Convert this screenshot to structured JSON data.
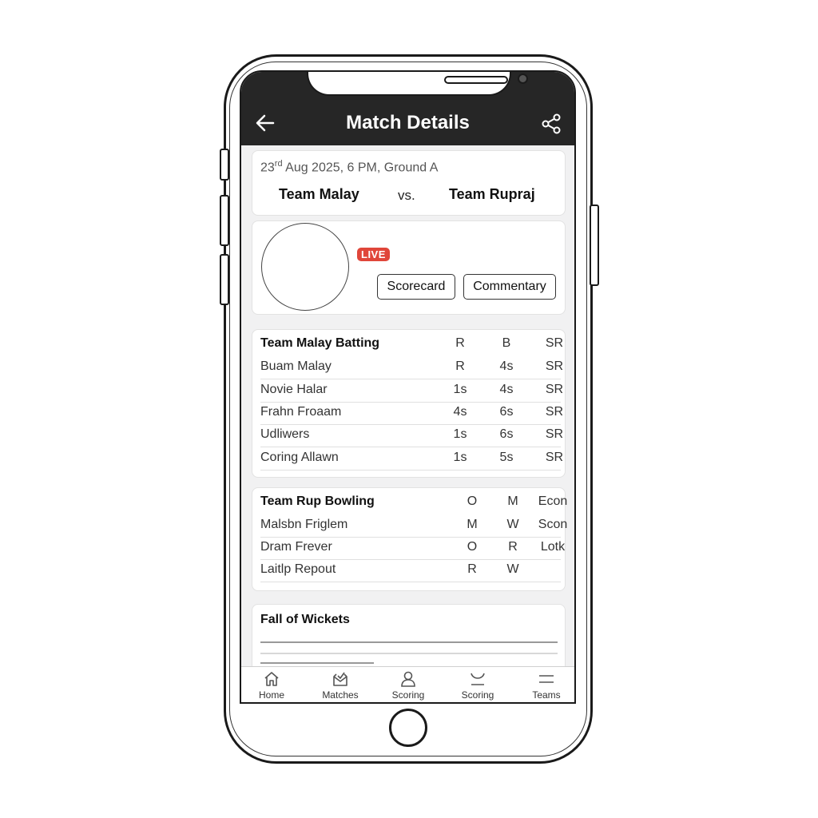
{
  "header": {
    "title": "Match Details"
  },
  "match": {
    "date_day": "23",
    "date_suffix": "rd",
    "date_rest": " Aug 2025, 6 PM, Ground A",
    "team_a": "Team Malay",
    "vs": "vs.",
    "team_b": "Team Rupraj"
  },
  "live": {
    "badge": "LIVE",
    "scorecard_label": "Scorecard",
    "commentary_label": "Commentary"
  },
  "batting": {
    "title": "Team Malay Batting",
    "headers": [
      "R",
      "B",
      "SR"
    ],
    "rows": [
      {
        "name": "Buam Malay",
        "c1": "R",
        "c2": "4s",
        "c3": "SR"
      },
      {
        "name": "Novie Halar",
        "c1": "1s",
        "c2": "4s",
        "c3": "SR"
      },
      {
        "name": "Frahn Froaam",
        "c1": "4s",
        "c2": "6s",
        "c3": "SR"
      },
      {
        "name": "Udliwers",
        "c1": "1s",
        "c2": "6s",
        "c3": "SR"
      },
      {
        "name": "Coring Allawn",
        "c1": "1s",
        "c2": "5s",
        "c3": "SR"
      }
    ]
  },
  "bowling": {
    "title": "Team Rup Bowling",
    "headers": [
      "O",
      "M",
      "Econ"
    ],
    "rows": [
      {
        "name": "Malsbn Friglem",
        "c1": "M",
        "c2": "W",
        "c3": "Scon"
      },
      {
        "name": "Dram Frever",
        "c1": "O",
        "c2": "R",
        "c3": "Lotk"
      },
      {
        "name": "Laitlp Repout",
        "c1": "R",
        "c2": "W",
        "c3": ""
      }
    ]
  },
  "fall_of_wickets": {
    "title": "Fall of Wickets"
  },
  "tabs": [
    {
      "label": "Home",
      "icon": "home-icon"
    },
    {
      "label": "Matches",
      "icon": "matches-icon"
    },
    {
      "label": "Scoring",
      "icon": "user-icon"
    },
    {
      "label": "Scoring",
      "icon": "cup-icon"
    },
    {
      "label": "Teams",
      "icon": "menu-icon"
    }
  ],
  "colors": {
    "header_bg": "#262626",
    "live_badge": "#e0463a"
  }
}
